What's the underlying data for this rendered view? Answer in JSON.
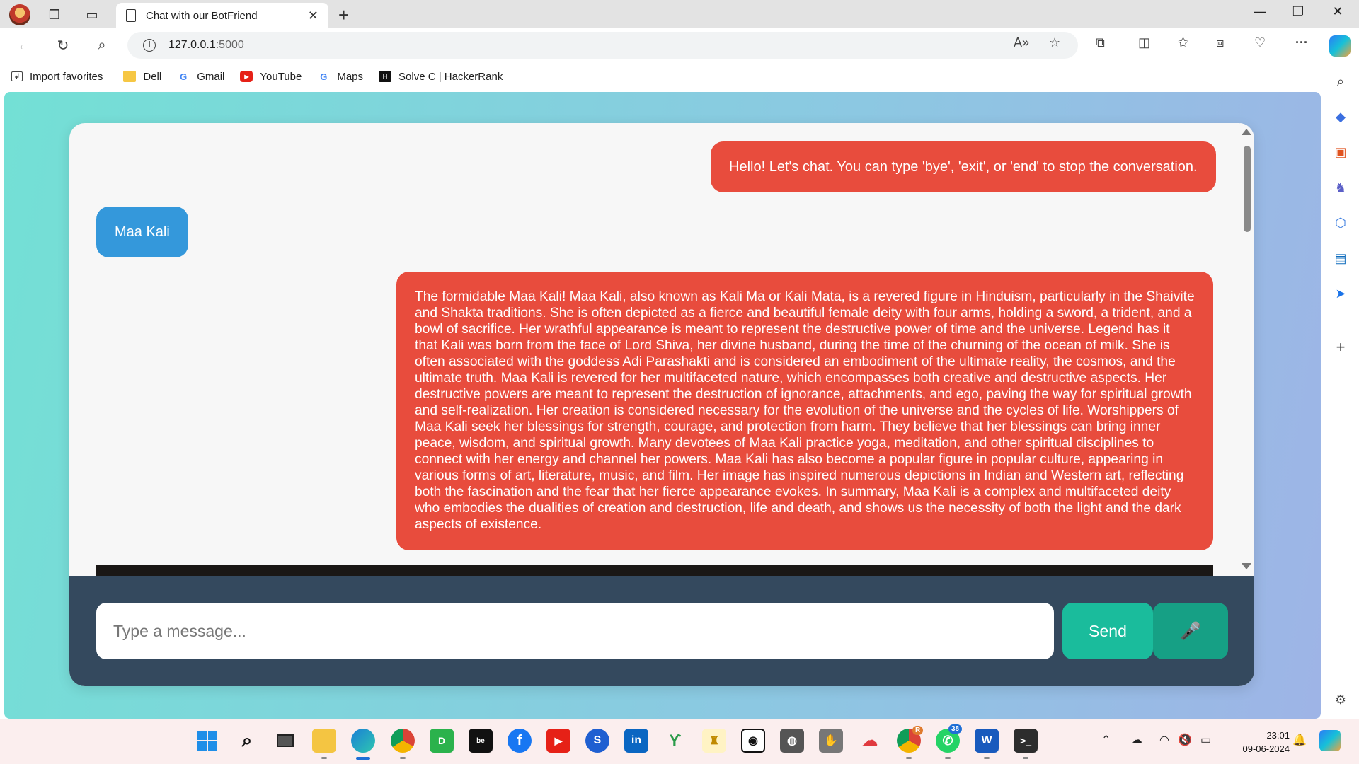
{
  "browser": {
    "tab_title": "Chat with our BotFriend",
    "address_host": "127.0.0.1",
    "address_port": ":5000"
  },
  "bookmarks": [
    {
      "label": "Import favorites",
      "icon": "import-icon"
    },
    {
      "label": "Dell",
      "icon": "folder-icon"
    },
    {
      "label": "Gmail",
      "icon": "google-icon"
    },
    {
      "label": "YouTube",
      "icon": "youtube-icon"
    },
    {
      "label": "Maps",
      "icon": "google-icon"
    },
    {
      "label": "Solve C | HackerRank",
      "icon": "hackerrank-icon"
    }
  ],
  "chat": {
    "messages": [
      {
        "sender": "bot",
        "text": "Hello! Let's chat. You can type 'bye', 'exit', or 'end' to stop the conversation."
      },
      {
        "sender": "user",
        "text": "Maa Kali"
      },
      {
        "sender": "bot",
        "text": "The formidable Maa Kali! Maa Kali, also known as Kali Ma or Kali Mata, is a revered figure in Hinduism, particularly in the Shaivite and Shakta traditions. She is often depicted as a fierce and beautiful female deity with four arms, holding a sword, a trident, and a bowl of sacrifice. Her wrathful appearance is meant to represent the destructive power of time and the universe. Legend has it that Kali was born from the face of Lord Shiva, her divine husband, during the time of the churning of the ocean of milk. She is often associated with the goddess Adi Parashakti and is considered an embodiment of the ultimate reality, the cosmos, and the ultimate truth. Maa Kali is revered for her multifaceted nature, which encompasses both creative and destructive aspects. Her destructive powers are meant to represent the destruction of ignorance, attachments, and ego, paving the way for spiritual growth and self-realization. Her creation is considered necessary for the evolution of the universe and the cycles of life. Worshippers of Maa Kali seek her blessings for strength, courage, and protection from harm. They believe that her blessings can bring inner peace, wisdom, and spiritual growth. Many devotees of Maa Kali practice yoga, meditation, and other spiritual disciplines to connect with her energy and channel her powers. Maa Kali has also become a popular figure in popular culture, appearing in various forms of art, literature, music, and film. Her image has inspired numerous depictions in Indian and Western art, reflecting both the fascination and the fear that her fierce appearance evokes. In summary, Maa Kali is a complex and multifaceted deity who embodies the dualities of creation and destruction, life and death, and shows us the necessity of both the light and the dark aspects of existence."
      }
    ],
    "input_placeholder": "Type a message...",
    "input_value": "",
    "send_label": "Send",
    "mic_icon": "microphone-icon"
  },
  "taskbar": {
    "time": "23:01",
    "date": "09-06-2024",
    "whatsapp_badge": "38",
    "chrome_badge": "R"
  },
  "colors": {
    "bot_bubble": "#e84c3d",
    "user_bubble": "#3498db",
    "input_bar": "#34495e",
    "send_button": "#1abc9c",
    "mic_button": "#16a085"
  }
}
